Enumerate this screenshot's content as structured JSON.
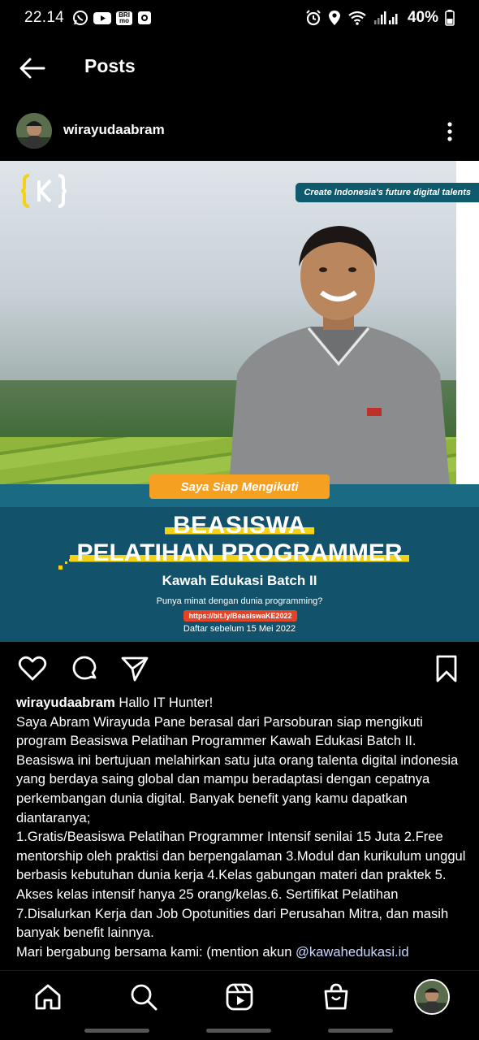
{
  "status_bar": {
    "time": "22.14",
    "battery": "40%",
    "bri_label": "BRI mo"
  },
  "header": {
    "title": "Posts"
  },
  "post": {
    "username": "wirayudaabram",
    "image": {
      "tagline": "Create Indonesia's future digital talents",
      "ribbon": "Saya Siap Mengikuti",
      "headline_1": "BEASISWA",
      "headline_2": "PELATIHAN PROGRAMMER",
      "batch": "Kawah Edukasi Batch II",
      "question": "Punya minat dengan dunia programming?",
      "link": "https://bit.ly/BeasiswaKE2022",
      "deadline": "Daftar sebelum 15 Mei 2022"
    },
    "caption": {
      "author": "wirayudaabram",
      "first_line": "Hallo IT Hunter!",
      "p1": "Saya Abram Wirayuda Pane berasal dari Parsoburan siap mengikuti program Beasiswa Pelatihan Programmer Kawah Edukasi Batch II. Beasiswa ini bertujuan melahirkan satu juta orang talenta digital indonesia yang berdaya saing global dan mampu beradaptasi dengan cepatnya perkembangan dunia digital. Banyak benefit yang kamu dapatkan diantaranya;",
      "p2": "1.Gratis/Beasiswa Pelatihan Programmer Intensif senilai 15 Juta 2.Free mentorship oleh praktisi dan berpengalaman 3.Modul dan kurikulum unggul berbasis kebutuhan dunia kerja 4.Kelas gabungan materi dan praktek 5.   Akses kelas intensif hanya 25 orang/kelas.6. Sertifikat Pelatihan 7.Disalurkan Kerja dan Job Opotunities dari Perusahan Mitra, dan masih banyak benefit lainnya.",
      "p3_text": "Mari bergabung bersama kami: (mention akun ",
      "p3_mention": "@kawahedukasi.id"
    }
  },
  "colors": {
    "background": "#000000",
    "banner_blue": "#12526b",
    "highlight_yellow": "#f4d216",
    "ribbon_orange": "#f6a021",
    "link_red": "#e44328"
  },
  "icons": [
    "whatsapp-icon",
    "youtube-icon",
    "brimo-icon",
    "camera-icon",
    "alarm-icon",
    "location-icon",
    "wifi-icon",
    "signal-icon",
    "battery-icon",
    "back-arrow-icon",
    "more-vertical-icon",
    "heart-icon",
    "comment-icon",
    "share-icon",
    "bookmark-icon",
    "home-icon",
    "search-icon",
    "reels-icon",
    "shop-icon",
    "profile-avatar"
  ]
}
